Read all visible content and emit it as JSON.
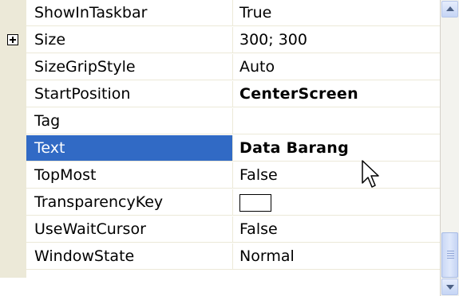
{
  "properties": [
    {
      "name": "ShowInTaskbar",
      "value": "True"
    },
    {
      "name": "Size",
      "value": "300; 300",
      "expandable": true
    },
    {
      "name": "SizeGripStyle",
      "value": "Auto"
    },
    {
      "name": "StartPosition",
      "value": "CenterScreen",
      "bold": true
    },
    {
      "name": "Tag",
      "value": ""
    },
    {
      "name": "Text",
      "value": "Data Barang",
      "bold": true,
      "selected": true
    },
    {
      "name": "TopMost",
      "value": "False"
    },
    {
      "name": "TransparencyKey",
      "value": "",
      "color_swatch": true
    },
    {
      "name": "UseWaitCursor",
      "value": "False"
    },
    {
      "name": "WindowState",
      "value": "Normal"
    }
  ],
  "colors": {
    "selection": "#316ac5",
    "gutter": "#ece9d8",
    "scrollbar_track": "#f3f3ee"
  },
  "icons": {
    "expander": "plus-box-icon",
    "cursor": "mouse-pointer-icon",
    "scroll_up": "chevron-up-icon",
    "scroll_down": "chevron-down-icon"
  }
}
